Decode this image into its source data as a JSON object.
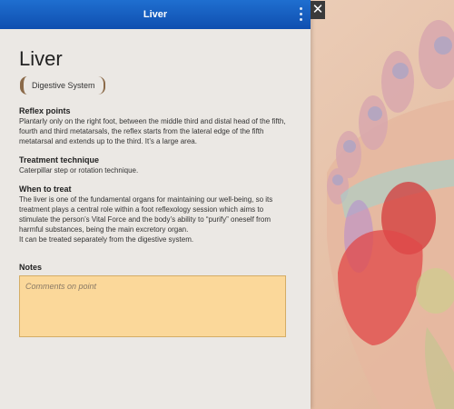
{
  "window": {
    "title": "Liver"
  },
  "close_label": "✕",
  "page": {
    "heading": "Liver",
    "category": "Digestive System",
    "sections": [
      {
        "title": "Reflex points",
        "text": "Plantarly only on the right foot, between the middle third and distal head of the fifth, fourth and third metatarsals, the reflex starts from the lateral edge of the fifth metatarsal and extends up to the third. It’s a large area."
      },
      {
        "title": "Treatment technique",
        "text": "Caterpillar step or rotation technique."
      },
      {
        "title": "When to treat",
        "text": "The liver is one of the fundamental organs for maintaining our well-being, so its treatment plays a central role within a foot reflexology session which aims to stimulate the person’s Vital Force and the body’s ability to “purify” oneself from harmful substances, being the main excretory organ.",
        "text2": "It can be treated separately from the digestive system."
      }
    ],
    "notes": {
      "label": "Notes",
      "placeholder": "Comments on point"
    }
  },
  "colors": {
    "titlebar": "#1456b8",
    "notes_bg": "#fbd89a",
    "chip_border": "#8b6a49"
  },
  "icons": {
    "menu": "kebab-menu-icon",
    "close": "close-icon"
  }
}
